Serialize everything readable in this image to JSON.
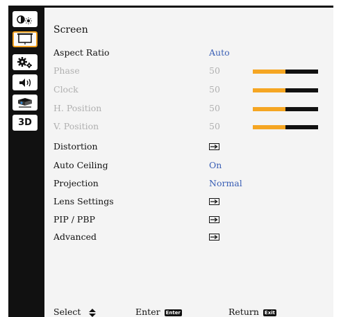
{
  "sidebar": {
    "items": [
      {
        "icon": "brightness-contrast-icon"
      },
      {
        "icon": "screen-icon",
        "active": true
      },
      {
        "icon": "settings-gears-icon"
      },
      {
        "icon": "audio-volume-icon"
      },
      {
        "icon": "projector-icon"
      },
      {
        "label": "3D",
        "icon": "3d-icon"
      }
    ]
  },
  "menu": {
    "title": "Screen",
    "rows": [
      {
        "label": "Aspect Ratio",
        "value": "Auto",
        "type": "value",
        "enabled": true
      },
      {
        "label": "Phase",
        "value": "50",
        "type": "slider",
        "level": 0.5,
        "enabled": false
      },
      {
        "label": "Clock",
        "value": "50",
        "type": "slider",
        "level": 0.5,
        "enabled": false
      },
      {
        "label": "H. Position",
        "value": "50",
        "type": "slider",
        "level": 0.5,
        "enabled": false
      },
      {
        "label": "V. Position",
        "value": "50",
        "type": "slider",
        "level": 0.5,
        "enabled": false
      },
      {
        "label": "Distortion",
        "type": "submenu",
        "enabled": true
      },
      {
        "label": "Auto Ceiling",
        "value": "On",
        "type": "value",
        "enabled": true
      },
      {
        "label": "Projection",
        "value": "Normal",
        "type": "value",
        "enabled": true
      },
      {
        "label": "Lens Settings",
        "type": "submenu",
        "enabled": true
      },
      {
        "label": "PIP / PBP",
        "type": "submenu",
        "enabled": true
      },
      {
        "label": "Advanced",
        "type": "submenu",
        "enabled": true
      }
    ]
  },
  "footer": {
    "select_label": "Select",
    "enter_label": "Enter",
    "enter_key": "Enter",
    "return_label": "Return",
    "return_key": "Exit"
  },
  "colors": {
    "value_blue": "#3a5fb5",
    "slider_fill": "#f5a623",
    "active_border": "#f0a020",
    "disabled_text": "#b0b0b0"
  }
}
